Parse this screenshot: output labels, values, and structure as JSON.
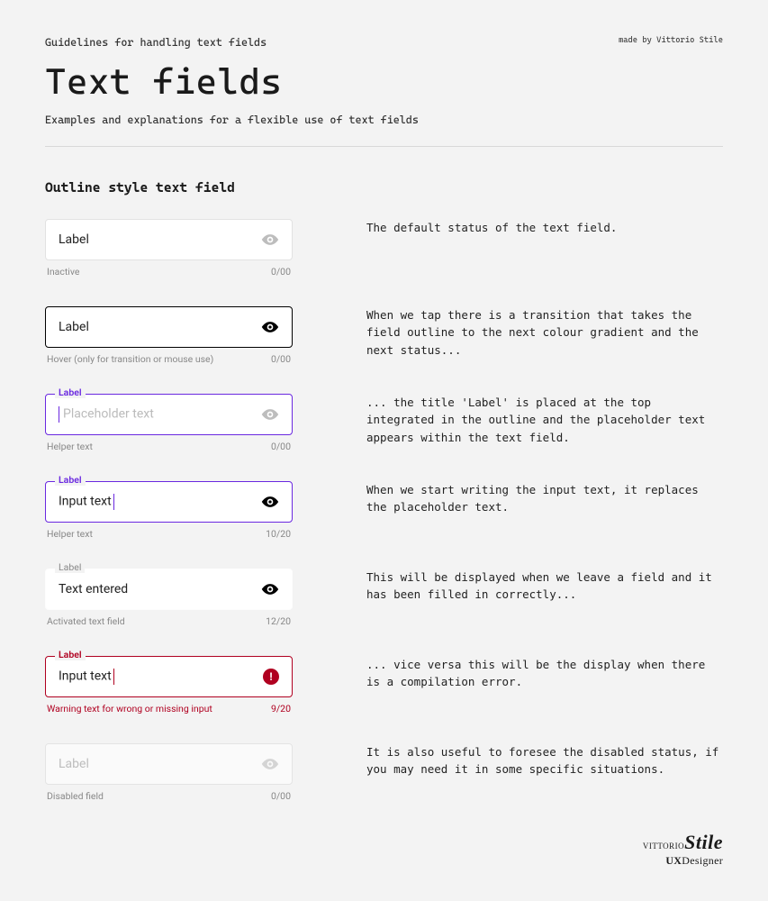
{
  "header": {
    "eyebrow": "Guidelines for handling text fields",
    "credit": "made by Vittorio Stile",
    "title": "Text fields",
    "subtitle": "Examples and explanations for a flexible use of text fields"
  },
  "section_heading": "Outline style text field",
  "states": {
    "inactive": {
      "label": "Label",
      "helper": "Inactive",
      "counter": "0/00",
      "desc": "The default status of the text field."
    },
    "hover": {
      "label": "Label",
      "helper": "Hover (only for transition or mouse use)",
      "counter": "0/00",
      "desc": "When we tap there is a transition that takes the field outline to the next colour gradient and the next status..."
    },
    "focus": {
      "label": "Label",
      "placeholder": "Placeholder text",
      "helper": "Helper text",
      "counter": "0/00",
      "desc": "... the title 'Label' is placed at the top integrated in the outline and the placeholder text appears within the text field."
    },
    "focus_fill": {
      "label": "Label",
      "input": "Input text",
      "helper": "Helper text",
      "counter": "10/20",
      "desc": "When we start writing the input text, it replaces the placeholder text."
    },
    "activated": {
      "label": "Label",
      "input": "Text entered",
      "helper": "Activated text field",
      "counter": "12/20",
      "desc": "This will be displayed when we leave a field and it has been filled in correctly..."
    },
    "error": {
      "label": "Label",
      "input": "Input text",
      "helper": "Warning text for wrong or missing input",
      "counter": "9/20",
      "desc": "... vice versa this will be the display when there is a compilation error."
    },
    "disabled": {
      "label": "Label",
      "helper": "Disabled field",
      "counter": "0/00",
      "desc": "It is also useful to foresee the disabled status, if you may need it in some specific situations."
    }
  },
  "footer": {
    "brand_small": "VITTORIO",
    "brand_big": "Stile",
    "role_bold": "UX",
    "role_rest": "Designer"
  }
}
